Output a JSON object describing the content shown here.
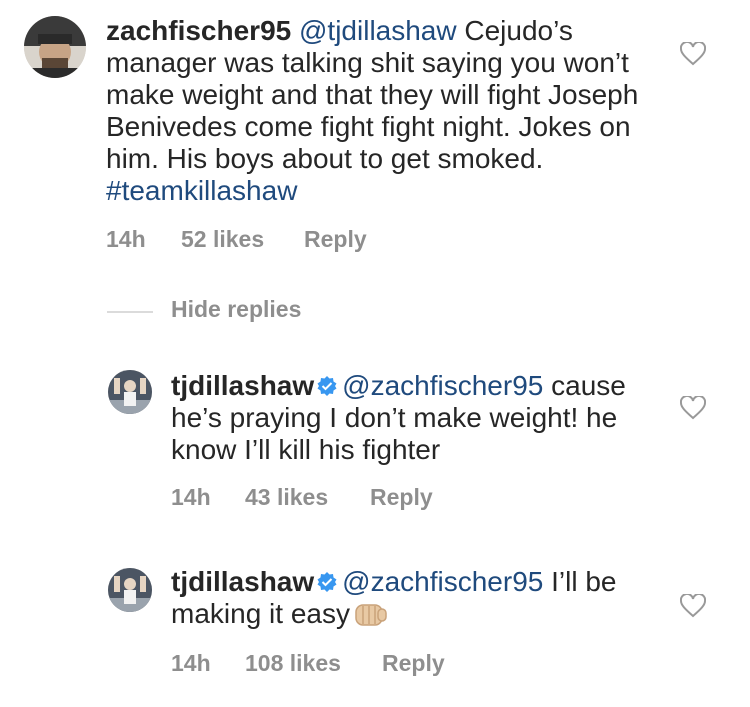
{
  "comments": [
    {
      "username": "zachfischer95",
      "mention": "@tjdillashaw",
      "text_before_hashtag": "Cejudo’s manager was talking shit saying you won’t make weight and that they will fight Joseph Benivedes come fight fight night. Jokes on him. His boys about to get smoked.",
      "hashtag": "#teamkillashaw",
      "time": "14h",
      "likes": "52 likes",
      "reply": "Reply"
    }
  ],
  "hide_replies": "Hide replies",
  "replies": [
    {
      "username": "tjdillashaw",
      "verified": true,
      "mention": "@zachfischer95",
      "text": "cause he’s praying I don’t make weight! he know I’ll kill his fighter",
      "time": "14h",
      "likes": "43 likes",
      "reply": "Reply"
    },
    {
      "username": "tjdillashaw",
      "verified": true,
      "mention": "@zachfischer95",
      "text": "I’ll be making it easy",
      "emoji": "fist-bump-icon",
      "time": "14h",
      "likes": "108 likes",
      "reply": "Reply"
    }
  ],
  "colors": {
    "text": "#262626",
    "mention": "#1f4a7d",
    "meta": "#8e8e8e",
    "verified": "#3897f0"
  }
}
